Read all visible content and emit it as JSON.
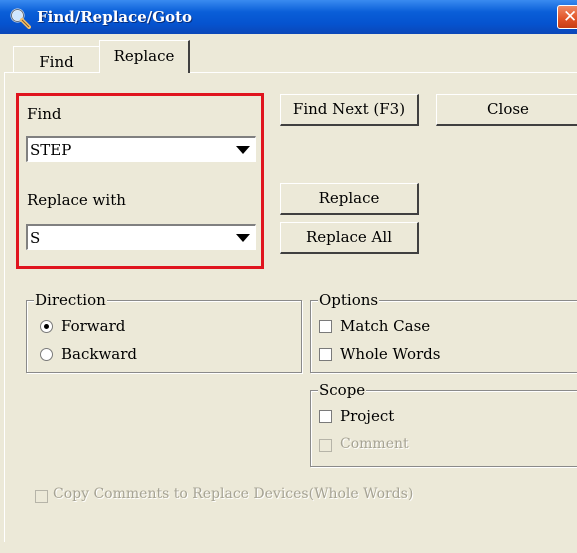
{
  "window": {
    "title": "Find/Replace/Goto",
    "close_glyph": "✕"
  },
  "tabs": [
    {
      "label": "Find",
      "active": false
    },
    {
      "label": "Replace",
      "active": true
    }
  ],
  "find": {
    "label": "Find",
    "value": "STEP"
  },
  "replace_with": {
    "label": "Replace with",
    "value": "S"
  },
  "buttons": {
    "find_next": "Find Next (F3)",
    "close": "Close",
    "replace": "Replace",
    "replace_all": "Replace All"
  },
  "direction": {
    "title": "Direction",
    "options": [
      {
        "label": "Forward",
        "selected": true
      },
      {
        "label": "Backward",
        "selected": false
      }
    ]
  },
  "options": {
    "title": "Options",
    "items": [
      {
        "label": "Match Case",
        "checked": false
      },
      {
        "label": "Whole Words",
        "checked": false
      }
    ]
  },
  "scope": {
    "title": "Scope",
    "items": [
      {
        "label": "Project",
        "checked": false,
        "enabled": true
      },
      {
        "label": "Comment",
        "checked": false,
        "enabled": false
      }
    ]
  },
  "copy_comments": {
    "label": "Copy Comments to Replace Devices(Whole Words)",
    "checked": false,
    "enabled": false
  },
  "highlight_color": "#e0141e",
  "icons": {
    "title_icon": "magnifier-icon",
    "dropdown": "dropdown-arrow-icon"
  }
}
